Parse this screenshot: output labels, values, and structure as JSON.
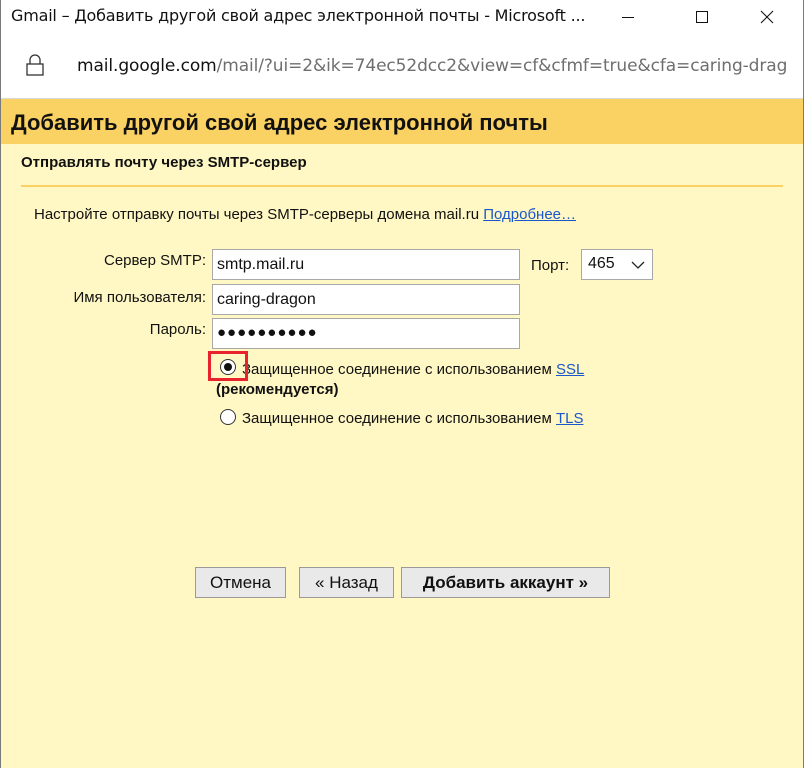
{
  "window": {
    "title": "Gmail – Добавить другой свой адрес электронной почты - Microsoft ...",
    "url_domain": "mail.google.com",
    "url_path": "/mail/?ui=2&ik=74ec52dcc2&view=cf&cfmf=true&cfa=caring-drag"
  },
  "dialog": {
    "header": "Добавить другой свой адрес электронной почты",
    "section_title": "Отправлять почту через SMTP-сервер",
    "intro_text": "Настройте отправку почты через SMTP-серверы домена mail.ru",
    "intro_link": "Подробнее…"
  },
  "form": {
    "smtp_label": "Сервер SMTP:",
    "smtp_value": "smtp.mail.ru",
    "port_label": "Порт:",
    "port_value": "465",
    "username_label": "Имя пользователя:",
    "username_value": "caring-dragon",
    "password_label": "Пароль:",
    "password_value": "●●●●●●●●●●",
    "ssl_option_text": "Защищенное соединение с использованием",
    "ssl_link": "SSL",
    "ssl_recommended": "(рекомендуется)",
    "tls_option_text": "Защищенное соединение с использованием",
    "tls_link": "TLS",
    "ssl_selected": true
  },
  "buttons": {
    "cancel": "Отмена",
    "back": "« Назад",
    "add_account": "Добавить аккаунт »"
  },
  "colors": {
    "header_bg": "#fad163",
    "content_bg": "#fff8c4",
    "link": "#1a56cc",
    "highlight": "#e8232d"
  }
}
